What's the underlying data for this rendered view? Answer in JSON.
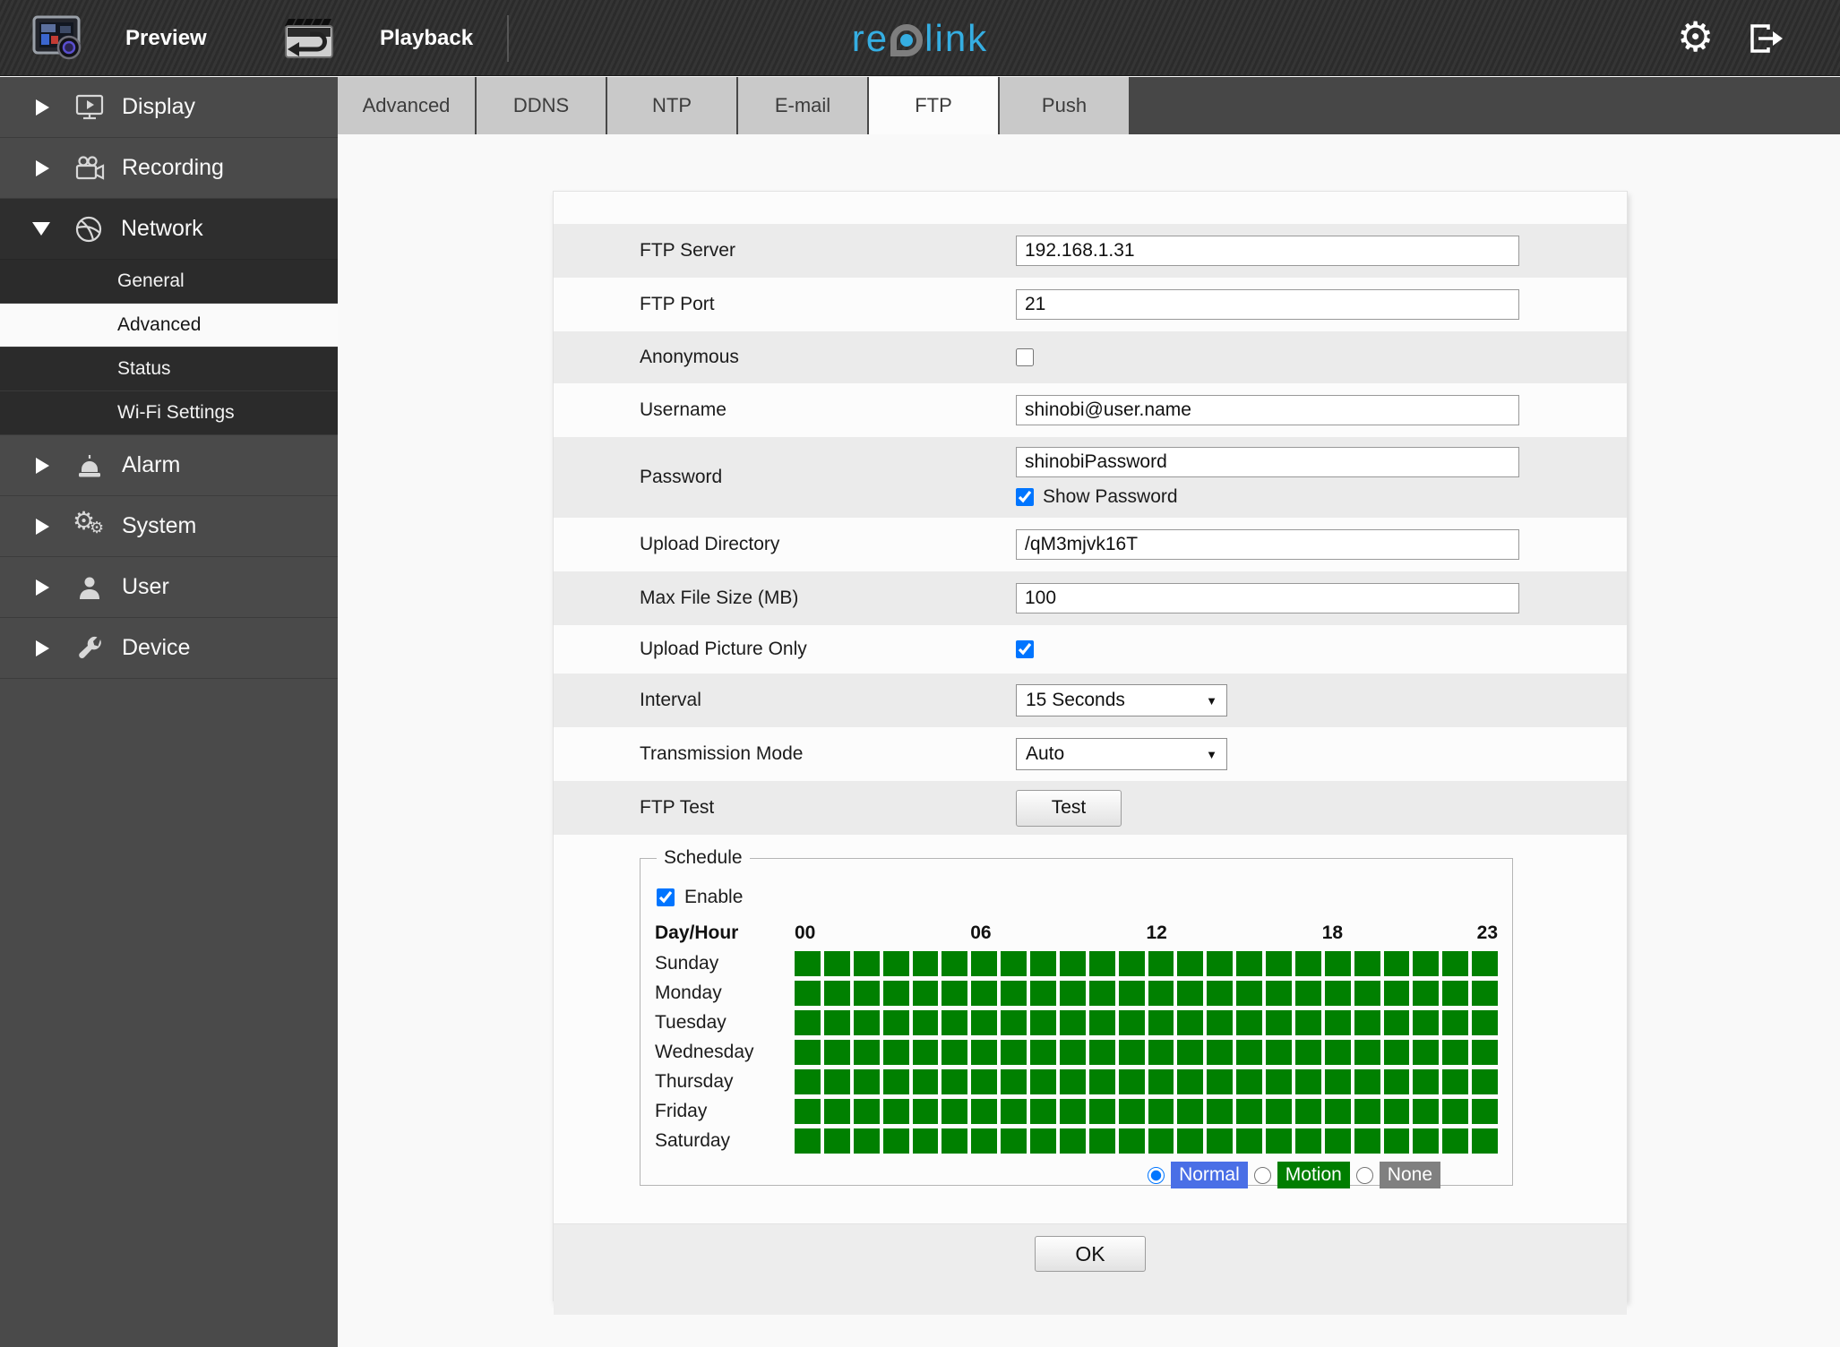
{
  "topbar": {
    "preview_label": "Preview",
    "playback_label": "Playback",
    "logo_re": "re",
    "logo_link": "link"
  },
  "sidebar": {
    "items": [
      {
        "label": "Display"
      },
      {
        "label": "Recording"
      },
      {
        "label": "Network",
        "expanded": true,
        "children": [
          {
            "label": "General",
            "selected": false
          },
          {
            "label": "Advanced",
            "selected": true
          },
          {
            "label": "Status",
            "selected": false
          },
          {
            "label": "Wi-Fi Settings",
            "selected": false
          }
        ]
      },
      {
        "label": "Alarm"
      },
      {
        "label": "System"
      },
      {
        "label": "User"
      },
      {
        "label": "Device"
      }
    ]
  },
  "tabs": [
    {
      "label": "Advanced",
      "active": false
    },
    {
      "label": "DDNS",
      "active": false
    },
    {
      "label": "NTP",
      "active": false
    },
    {
      "label": "E-mail",
      "active": false
    },
    {
      "label": "FTP",
      "active": true
    },
    {
      "label": "Push",
      "active": false
    }
  ],
  "form": {
    "ftp_server": {
      "label": "FTP Server",
      "value": "192.168.1.31"
    },
    "ftp_port": {
      "label": "FTP Port",
      "value": "21"
    },
    "anonymous": {
      "label": "Anonymous",
      "checked": false
    },
    "username": {
      "label": "Username",
      "value": "shinobi@user.name"
    },
    "password": {
      "label": "Password",
      "value": "shinobiPassword",
      "show_password_label": "Show Password",
      "show_password_checked": true
    },
    "upload_directory": {
      "label": "Upload Directory",
      "value": "/qM3mjvk16T"
    },
    "max_file_size": {
      "label": "Max File Size (MB)",
      "value": "100"
    },
    "upload_picture_only": {
      "label": "Upload Picture Only",
      "checked": true
    },
    "interval": {
      "label": "Interval",
      "value": "15 Seconds"
    },
    "transmission_mode": {
      "label": "Transmission Mode",
      "value": "Auto"
    },
    "ftp_test": {
      "label": "FTP Test",
      "button_label": "Test"
    }
  },
  "schedule": {
    "legend": "Schedule",
    "enable_label": "Enable",
    "enable_checked": true,
    "day_hour_label": "Day/Hour",
    "hour_labels": [
      "00",
      "06",
      "12",
      "18",
      "23"
    ],
    "days": [
      "Sunday",
      "Monday",
      "Tuesday",
      "Wednesday",
      "Thursday",
      "Friday",
      "Saturday"
    ],
    "hours_per_day": 24,
    "cell_color": "#008000",
    "states": [
      {
        "label": "Normal",
        "color": "#4a6fe6",
        "selected": true
      },
      {
        "label": "Motion",
        "color": "#007e00",
        "selected": false
      },
      {
        "label": "None",
        "color": "#808080",
        "selected": false
      }
    ]
  },
  "footer": {
    "ok_label": "OK"
  },
  "icons": {
    "select_arrow": "▼",
    "gear": "⚙"
  }
}
